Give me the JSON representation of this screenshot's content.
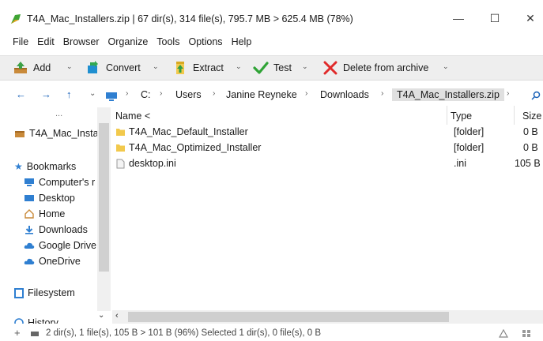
{
  "window": {
    "title": "T4A_Mac_Installers.zip | 67 dir(s), 314 file(s), 795.7 MB > 625.4 MB (78%)",
    "minimize": "—",
    "maximize": "☐",
    "close": "✕"
  },
  "menu": [
    "File",
    "Edit",
    "Browser",
    "Organize",
    "Tools",
    "Options",
    "Help"
  ],
  "toolbar": {
    "add": "Add",
    "convert": "Convert",
    "extract": "Extract",
    "test": "Test",
    "delete": "Delete from archive"
  },
  "address": {
    "back": "←",
    "forward": "→",
    "up": "↑",
    "crumbs": [
      "C:",
      "Users",
      "Janine Reyneke",
      "Downloads",
      "T4A_Mac_Installers.zip"
    ]
  },
  "tree": {
    "ellipsis": "...",
    "archive": "T4A_Mac_Insta",
    "bookmarks": "Bookmarks",
    "items": [
      "Computer's r",
      "Desktop",
      "Home",
      "Downloads",
      "Google Drive",
      "OneDrive"
    ],
    "filesystem": "Filesystem",
    "history": "History"
  },
  "columns": {
    "name": "Name <",
    "type": "Type",
    "size": "Size"
  },
  "files": [
    {
      "name": "T4A_Mac_Default_Installer",
      "type": "[folder]",
      "size": "0 B",
      "kind": "folder"
    },
    {
      "name": "T4A_Mac_Optimized_Installer",
      "type": "[folder]",
      "size": "0 B",
      "kind": "folder"
    },
    {
      "name": "desktop.ini",
      "type": ".ini",
      "size": "105 B",
      "kind": "file"
    }
  ],
  "status": {
    "text": "2 dir(s), 1 file(s), 105 B > 101 B (96%)   Selected 1 dir(s), 0 file(s), 0 B"
  },
  "colors": {
    "accent": "#1a62b8",
    "folder": "#f2c94c",
    "toolbar_bg": "#eeeeee"
  }
}
